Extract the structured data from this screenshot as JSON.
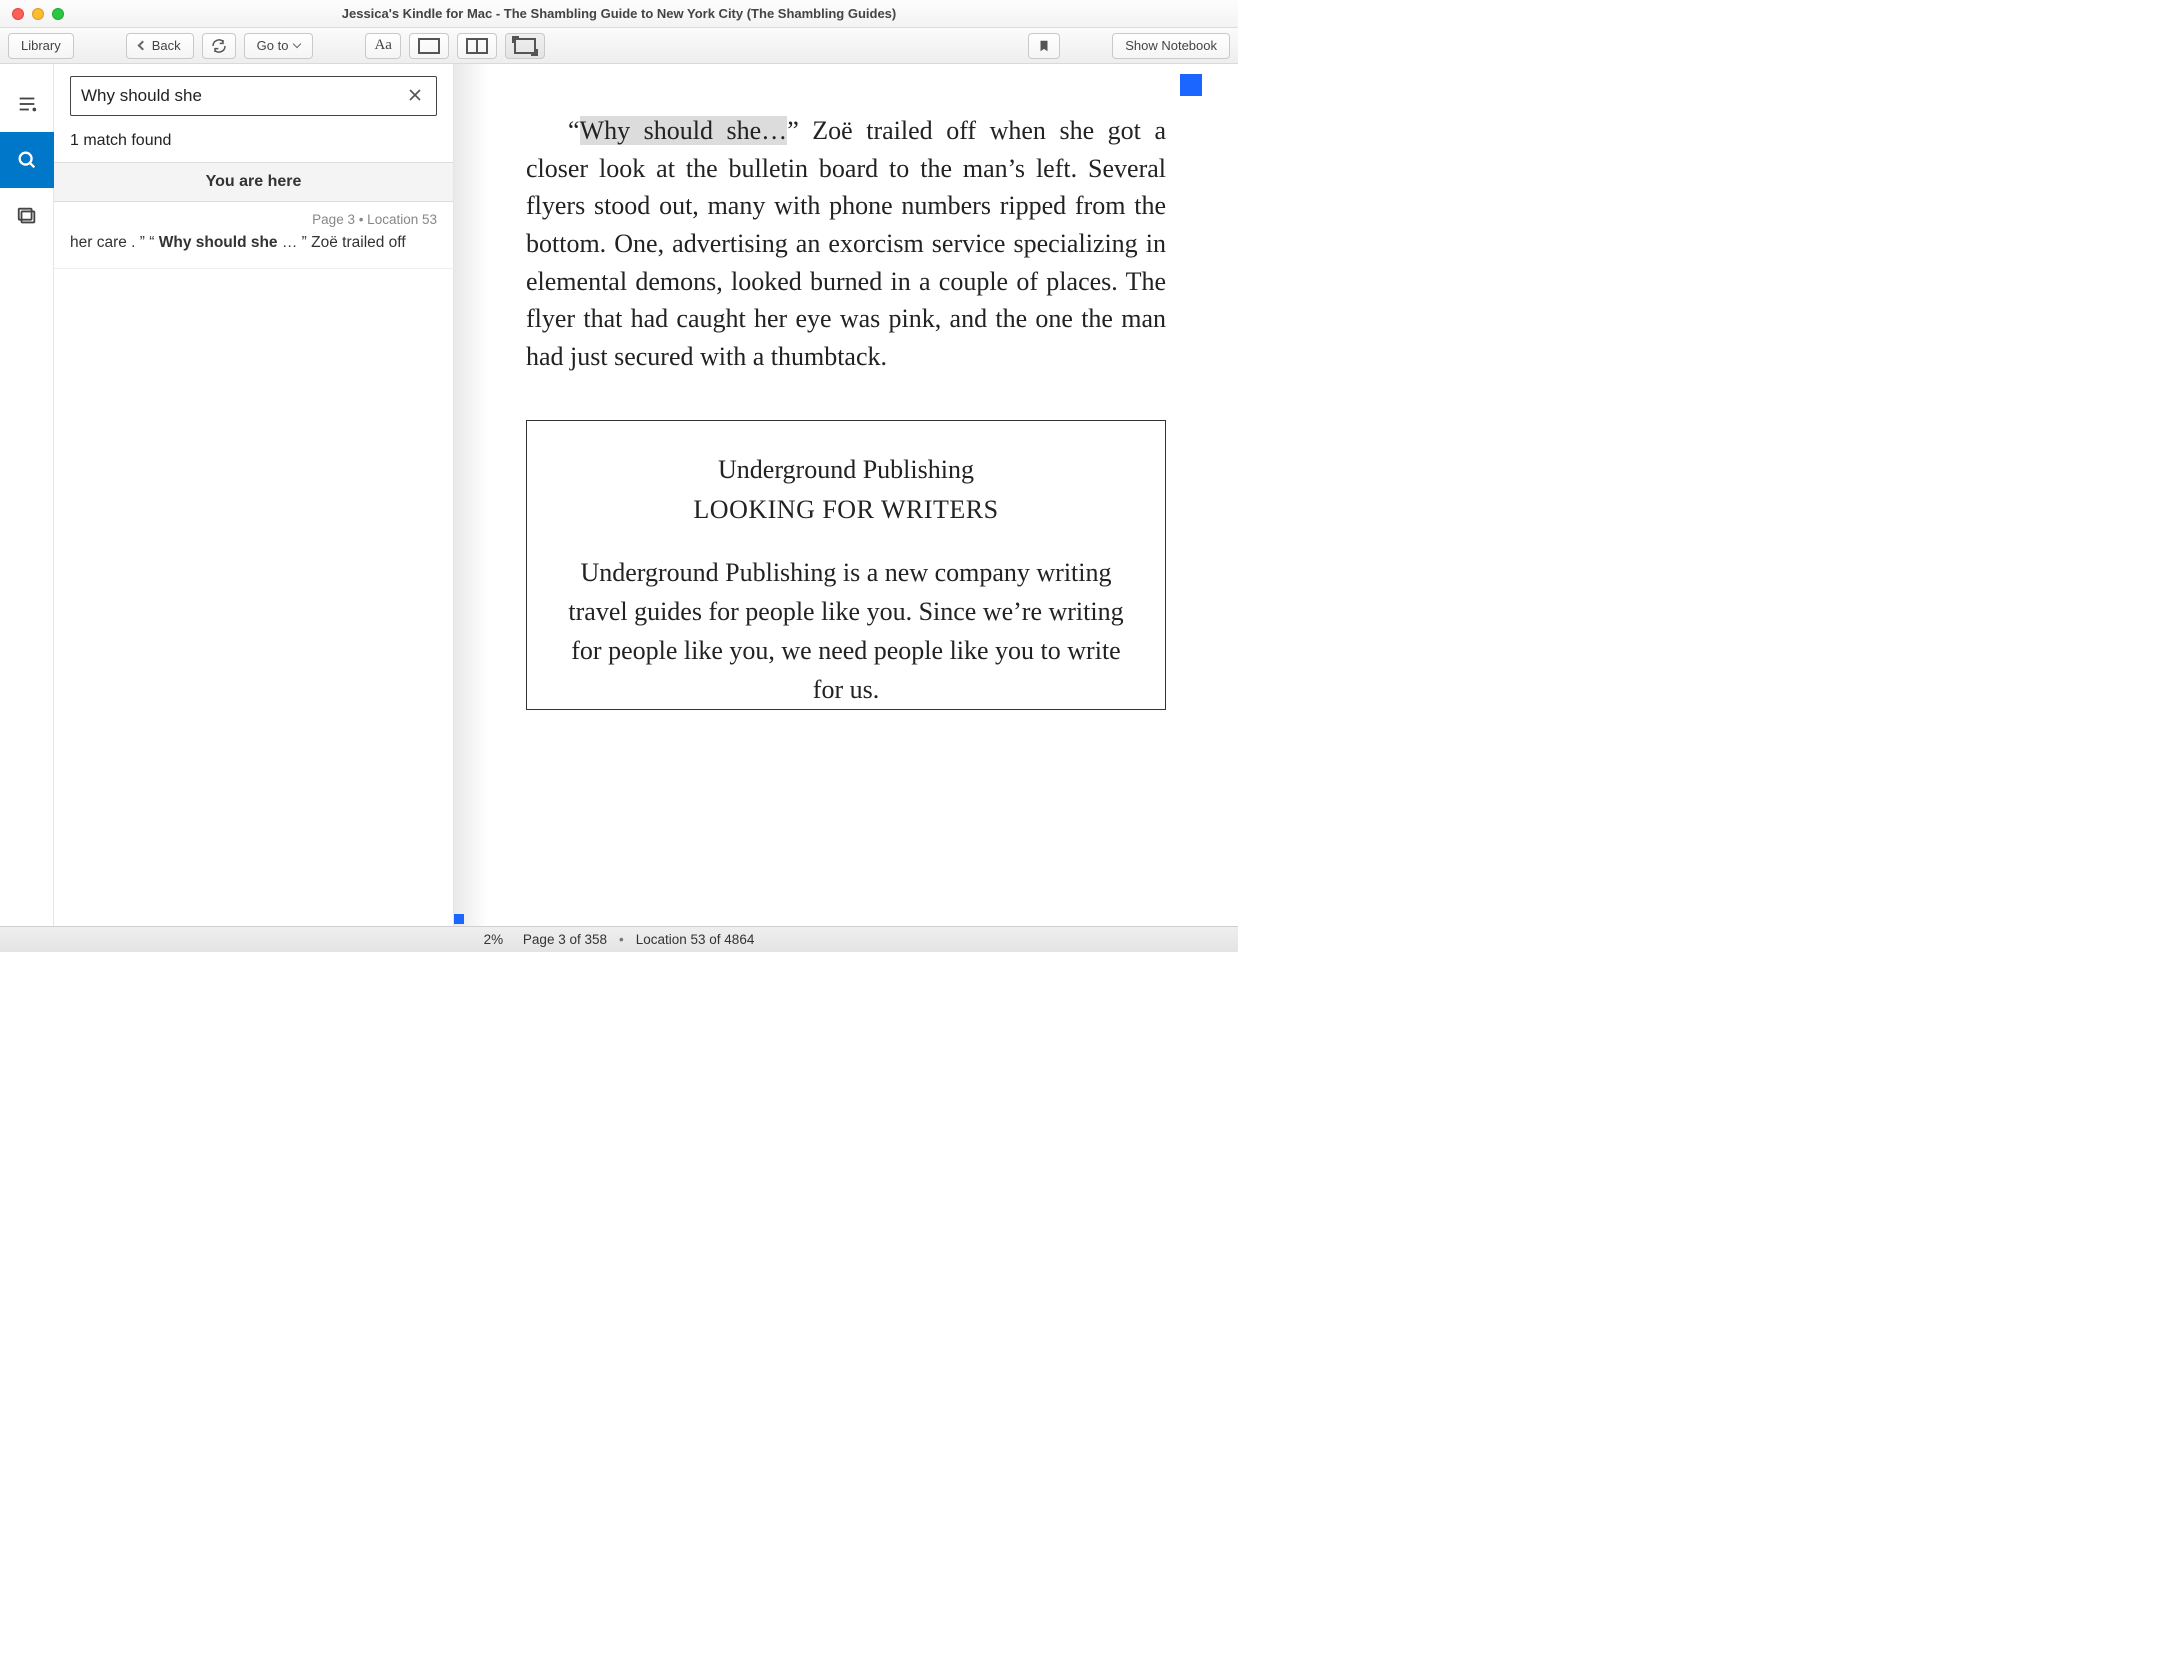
{
  "window": {
    "title": "Jessica's Kindle for Mac - The Shambling Guide to New York City (The Shambling Guides)"
  },
  "toolbar": {
    "library": "Library",
    "back": "Back",
    "goto": "Go to",
    "show_notebook": "Show Notebook"
  },
  "search": {
    "value": "Why should she",
    "placeholder": "",
    "match_count": "1 match found",
    "you_are_here": "You are here",
    "results": [
      {
        "location_line": "Page 3  •  Location 53",
        "snippet_pre": "her care . ” “ ",
        "snippet_bold": "Why should she",
        "snippet_post": " … ” Zoë trailed off"
      }
    ]
  },
  "reader": {
    "para_open_quote": "“",
    "para_highlight": "Why should she…",
    "para_rest": "” Zoë trailed off when she got a closer look at the bulletin board to the man’s left. Several flyers stood out, many with phone numbers ripped from the bottom. One, advertising an exorcism service specializing in elemental demons, looked burned in a couple of places. The flyer that had caught her eye was pink, and the one the man had just secured with a thumbtack.",
    "flyer": {
      "heading": "Underground Publishing",
      "sub": "LOOKING FOR WRITERS",
      "body": "Underground Publishing is a new company writing travel guides for people like you. Since we’re writing for people like you, we need people like you to write for us."
    }
  },
  "status": {
    "percent": "2%",
    "page": "Page 3 of 358",
    "location": "Location 53 of 4864"
  }
}
